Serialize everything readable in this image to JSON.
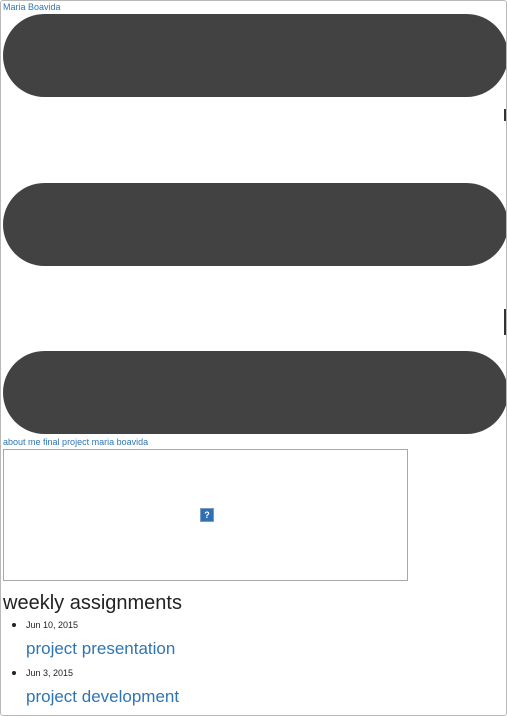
{
  "header": {
    "site_title": "Maria Boavida"
  },
  "nav": {
    "about_me": "about me",
    "final_project": "final project",
    "author_name": "maria boavida"
  },
  "main": {
    "section_title": "weekly assignments",
    "image_placeholder_glyph": "?",
    "posts": [
      {
        "date": "Jun 10, 2015",
        "title": "project presentation"
      },
      {
        "date": "Jun 3, 2015",
        "title": "project development"
      }
    ]
  },
  "colors": {
    "link": "#2e75b6",
    "bar": "#424242",
    "text": "#222222"
  },
  "icons": {
    "broken_image": "broken-image-icon"
  }
}
